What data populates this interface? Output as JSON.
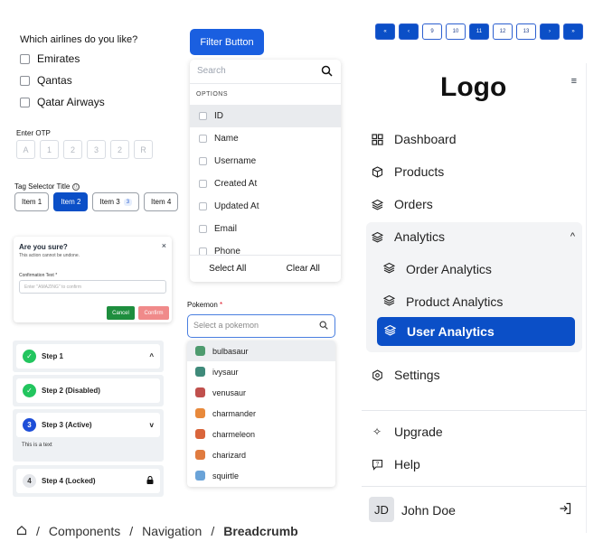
{
  "airlines": {
    "question": "Which airlines do you like?",
    "options": [
      "Emirates",
      "Qantas",
      "Qatar Airways"
    ]
  },
  "otp": {
    "label": "Enter OTP",
    "digits": [
      "A",
      "1",
      "2",
      "3",
      "2",
      "R"
    ]
  },
  "tag_selector": {
    "title": "Tag Selector Title",
    "info_icon": "ⓘ",
    "items": [
      {
        "label": "Item 1",
        "active": false
      },
      {
        "label": "Item 2",
        "active": true
      },
      {
        "label": "Item 3",
        "active": false,
        "count": "3"
      },
      {
        "label": "Item 4",
        "active": false
      }
    ]
  },
  "dialog": {
    "title": "Are you sure?",
    "subtitle": "This action cannot be undone.",
    "close": "×",
    "confirm_label": "Confirmation Text *",
    "input_placeholder": "Enter \"AMAZING\" to confirm",
    "cancel": "Cancel",
    "confirm": "Confirm"
  },
  "steps": [
    {
      "label": "Step 1",
      "state": "done",
      "arrow": "^"
    },
    {
      "label": "Step 2 (Disabled)",
      "state": "done"
    },
    {
      "label": "Step 3 (Active)",
      "state": "active",
      "number": "3",
      "arrow": "v",
      "body": "This is a text"
    },
    {
      "label": "Step 4 (Locked)",
      "state": "locked",
      "number": "4"
    }
  ],
  "breadcrumb": {
    "items": [
      "Components",
      "Navigation"
    ],
    "current": "Breadcrumb",
    "separator": "/"
  },
  "filter": {
    "button": "Filter Button",
    "search_placeholder": "Search",
    "options_header": "OPTIONS",
    "options": [
      "ID",
      "Name",
      "Username",
      "Created At",
      "Updated At",
      "Email",
      "Phone"
    ],
    "select_all": "Select All",
    "clear_all": "Clear All"
  },
  "pokemon": {
    "label": "Pokemon",
    "required": "*",
    "placeholder": "Select a pokemon",
    "list": [
      {
        "name": "bulbasaur",
        "color": "#4e9b6f"
      },
      {
        "name": "ivysaur",
        "color": "#3f8a7a"
      },
      {
        "name": "venusaur",
        "color": "#c0504d"
      },
      {
        "name": "charmander",
        "color": "#e8893b"
      },
      {
        "name": "charmeleon",
        "color": "#d9653b"
      },
      {
        "name": "charizard",
        "color": "#e07b3f"
      },
      {
        "name": "squirtle",
        "color": "#6aa3d8"
      }
    ]
  },
  "pagination": {
    "first": "«",
    "prev": "‹",
    "pages": [
      "9",
      "10",
      "11",
      "12",
      "13"
    ],
    "current": "11",
    "next": "›",
    "last": "»"
  },
  "sidebar": {
    "logo": "Logo",
    "collapse_icon": "≡",
    "nav": [
      "Dashboard",
      "Products",
      "Orders",
      "Analytics"
    ],
    "analytics_sub": [
      "Order Analytics",
      "Product Analytics",
      "User Analytics"
    ],
    "analytics_active": "User Analytics",
    "settings": "Settings",
    "upgrade": "Upgrade",
    "help": "Help",
    "user_initials": "JD",
    "user_name": "John Doe",
    "expand_arrow": "^"
  },
  "colors": {
    "primary": "#0b4fc7",
    "success": "#1e8e3e",
    "danger_soft": "#f08a8a"
  }
}
